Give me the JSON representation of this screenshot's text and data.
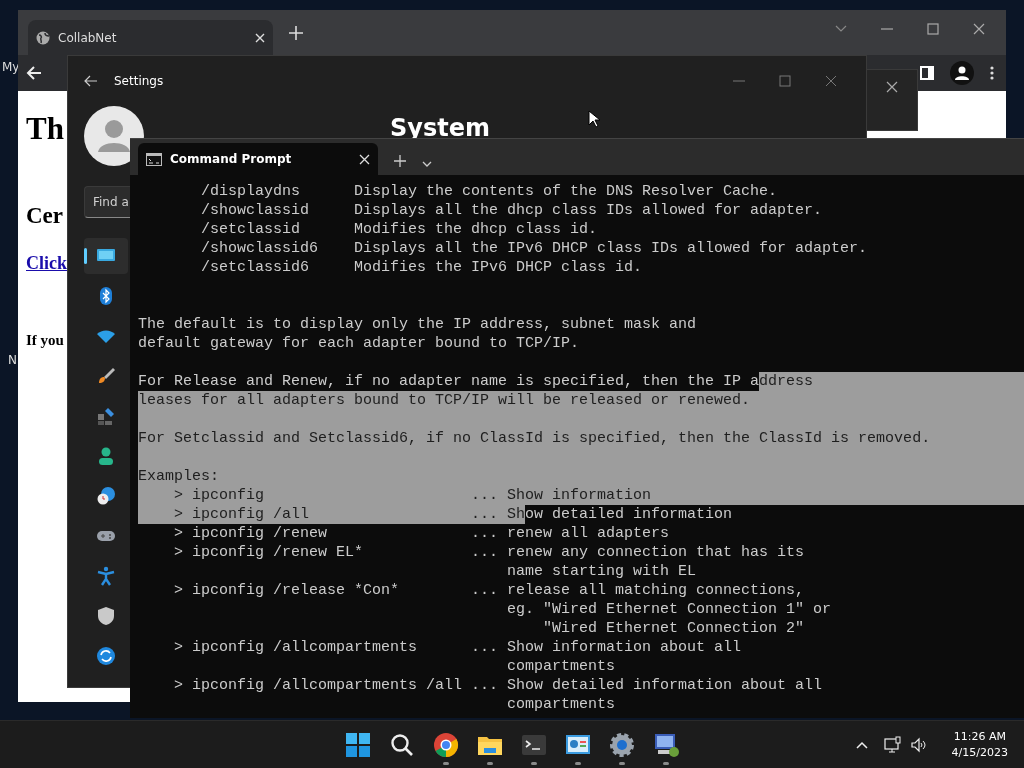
{
  "desktop": {
    "icon_labels": [
      "My",
      "N"
    ]
  },
  "browser": {
    "tabs": [
      {
        "title": "CollabNet",
        "selected": true
      }
    ],
    "page": {
      "heading": "Th",
      "subheading": "Cer",
      "link": "Click",
      "text": "If you"
    }
  },
  "settings": {
    "title": "Settings",
    "heading": "System",
    "search": {
      "placeholder": "Find a"
    },
    "sidebar": [
      {
        "selected": true
      },
      {
        "selected": false
      },
      {
        "selected": false
      },
      {
        "selected": false
      },
      {
        "selected": false
      },
      {
        "selected": false
      },
      {
        "selected": false
      },
      {
        "selected": false
      },
      {
        "selected": false
      },
      {
        "selected": false
      },
      {
        "selected": false
      }
    ]
  },
  "terminal": {
    "tabs": [
      {
        "title": "Command Prompt",
        "selected": true
      }
    ],
    "lines": [
      {
        "segments": [
          {
            "text": "       /displaydns      Display the contents of the DNS Resolver Cache.",
            "selected": false
          }
        ],
        "selected_to_end": false
      },
      {
        "segments": [
          {
            "text": "       /showclassid     Displays all the dhcp class IDs allowed for adapter.",
            "selected": false
          }
        ],
        "selected_to_end": false
      },
      {
        "segments": [
          {
            "text": "       /setclassid      Modifies the dhcp class id.",
            "selected": false
          }
        ],
        "selected_to_end": false
      },
      {
        "segments": [
          {
            "text": "       /showclassid6    Displays all the IPv6 DHCP class IDs allowed for adapter.",
            "selected": false
          }
        ],
        "selected_to_end": false
      },
      {
        "segments": [
          {
            "text": "       /setclassid6     Modifies the IPv6 DHCP class id.",
            "selected": false
          }
        ],
        "selected_to_end": false
      },
      {
        "selected_to_end": false
      },
      {
        "selected_to_end": false
      },
      {
        "segments": [
          {
            "text": "The default is to display only the IP address, subnet mask and",
            "selected": false
          }
        ],
        "selected_to_end": false
      },
      {
        "segments": [
          {
            "text": "default gateway for each adapter bound to TCP/IP.",
            "selected": false
          }
        ],
        "selected_to_end": false
      },
      {
        "selected_to_end": false
      },
      {
        "segments": [
          {
            "text": "For Release and Renew, if no adapter name is specified, then the IP a",
            "selected": false
          },
          {
            "text": "ddress",
            "selected": true
          }
        ],
        "selected_to_end": true
      },
      {
        "segments": [
          {
            "text": "leases for all adapters bound to TCP/IP will be released or renewed.",
            "selected": true
          }
        ],
        "selected_to_end": true
      },
      {
        "selected_to_end": true
      },
      {
        "segments": [
          {
            "text": "For Setclassid and Setclassid6, if no ClassId is specified, then the ClassId is removed.",
            "selected": true
          }
        ],
        "selected_to_end": true
      },
      {
        "selected_to_end": true
      },
      {
        "segments": [
          {
            "text": "Examples:",
            "selected": true
          }
        ],
        "selected_to_end": true
      },
      {
        "segments": [
          {
            "text": "    > ipconfig                       ... Show information",
            "selected": true
          }
        ],
        "selected_to_end": true
      },
      {
        "segments": [
          {
            "text": "    > ipconfig /all                  ... Sh",
            "selected": true
          },
          {
            "text": "ow detailed information",
            "selected": false
          }
        ],
        "selected_to_end": false
      },
      {
        "segments": [
          {
            "text": "    > ipconfig /renew                ... renew all adapters",
            "selected": false
          }
        ],
        "selected_to_end": false
      },
      {
        "segments": [
          {
            "text": "    > ipconfig /renew EL*            ... renew any connection that has its",
            "selected": false
          }
        ],
        "selected_to_end": false
      },
      {
        "segments": [
          {
            "text": "                                         name starting with EL",
            "selected": false
          }
        ],
        "selected_to_end": false
      },
      {
        "segments": [
          {
            "text": "    > ipconfig /release *Con*        ... release all matching connections,",
            "selected": false
          }
        ],
        "selected_to_end": false
      },
      {
        "segments": [
          {
            "text": "                                         eg. \"Wired Ethernet Connection 1\" or",
            "selected": false
          }
        ],
        "selected_to_end": false
      },
      {
        "segments": [
          {
            "text": "                                             \"Wired Ethernet Connection 2\"",
            "selected": false
          }
        ],
        "selected_to_end": false
      },
      {
        "segments": [
          {
            "text": "    > ipconfig /allcompartments      ... Show information about all",
            "selected": false
          }
        ],
        "selected_to_end": false
      },
      {
        "segments": [
          {
            "text": "                                         compartments",
            "selected": false
          }
        ],
        "selected_to_end": false
      },
      {
        "segments": [
          {
            "text": "    > ipconfig /allcompartments /all ... Show detailed information about all",
            "selected": false
          }
        ],
        "selected_to_end": false
      },
      {
        "segments": [
          {
            "text": "                                         compartments",
            "selected": false
          }
        ],
        "selected_to_end": false
      }
    ]
  },
  "taskbar": {
    "apps": [
      {
        "running": false
      },
      {
        "running": false
      },
      {
        "running": true
      },
      {
        "running": true
      },
      {
        "running": true
      },
      {
        "running": true
      },
      {
        "running": true
      },
      {
        "running": true
      }
    ],
    "time": "11:26 AM",
    "date": "4/15/2023"
  }
}
